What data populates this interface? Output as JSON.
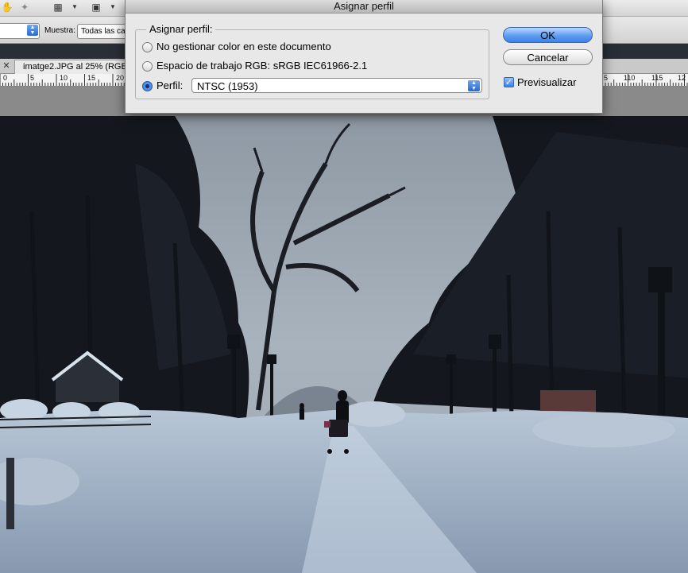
{
  "dialog": {
    "title": "Asignar perfil",
    "group_label": "Asignar perfil:",
    "options": [
      {
        "label": "No gestionar color en este documento",
        "selected": false
      },
      {
        "label": "Espacio de trabajo RGB: sRGB IEC61966-2.1",
        "selected": false
      },
      {
        "label": "Perfil:",
        "selected": true
      }
    ],
    "profile_value": "NTSC (1953)",
    "ok_label": "OK",
    "cancel_label": "Cancelar",
    "preview_label": "Previsualizar",
    "preview_checked": true
  },
  "toolbar": {
    "sample_label": "Muestra:",
    "sample_value": "Todas las ca"
  },
  "document": {
    "tab_title": "imatge2.JPG al 25% (RGB",
    "ruler_left": [
      "0",
      "5",
      "10",
      "15",
      "20"
    ],
    "ruler_right": [
      "5",
      "110",
      "115",
      "12"
    ]
  },
  "icons": {
    "close": "close-icon",
    "stepper": "stepper-arrows-icon"
  },
  "colors": {
    "accent": "#3c82ea",
    "sky": "#a9b3bd",
    "snow": "#c7d4e2"
  }
}
